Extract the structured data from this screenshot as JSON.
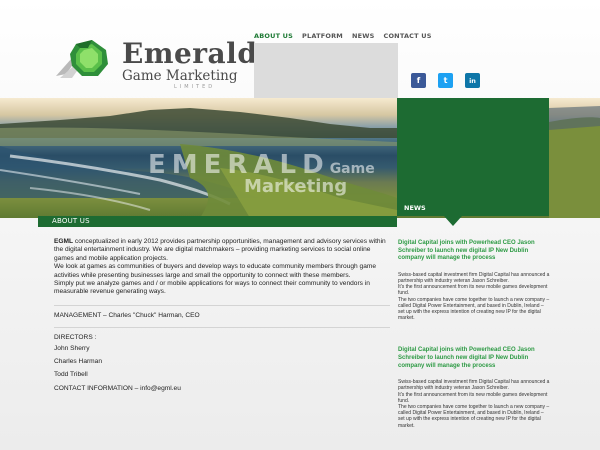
{
  "brand": {
    "title": "Emerald",
    "subtitle": "Game Marketing",
    "suffix": "LIMITED",
    "accent": "#1d6b32"
  },
  "nav": {
    "items": [
      "ABOUT US",
      "PLATFORM",
      "NEWS",
      "CONTACT US"
    ],
    "active": "ABOUT US"
  },
  "social": [
    {
      "icon": "facebook-icon",
      "glyph": "f",
      "color": "#3b5998"
    },
    {
      "icon": "twitter-icon",
      "glyph": "t",
      "color": "#1da1f2"
    },
    {
      "icon": "linkedin-icon",
      "glyph": "in",
      "color": "#0e76a8"
    }
  ],
  "banner": {
    "line1": "EMERALD",
    "line1b": "Game",
    "line2": "Marketing"
  },
  "sections": {
    "about_label": "ABOUT US",
    "news_label": "NEWS"
  },
  "about": {
    "lead": "EGML",
    "p1_rest": " conceptualized in early 2012 provides partnership opportunities, management and advisory services within the digital entertainment industry. We are digital matchmakers – providing marketing services to social online games and mobile application projects.",
    "p2": "We look at games as communities of buyers and develop ways to educate community members through game activities while presenting businesses large and small the opportunity to connect with these members.",
    "p3": "Simply put we analyze games and / or mobile applications for ways to connect their community to vendors in measurable revenue generating ways.",
    "management": "MANAGEMENT –  Charles \"Chuck\" Harman, CEO",
    "directors_title": "DIRECTORS :",
    "directors": [
      "John Sherry",
      "Charles Harman",
      "Todd Tribell"
    ],
    "contact": "CONTACT  INFORMATION – info@egml.eu"
  },
  "news": [
    {
      "headline": "Digital Capital joins with Powerhead CEO Jason Schreiber to launch new digital IP New Dublin company will manage the process",
      "body1": "Swiss-based capital investment firm Digital Capital has announced a partnership with industry veteran Jason Schreiber.",
      "body2": "It's the first announcement from its new mobile games development fund.",
      "body3": "The two companies have come together to launch a new company – called Digital Power Entertainment, and based in Dublin, Ireland – set up with the express intention of creating new IP for the digital market."
    },
    {
      "headline": "Digital Capital joins with Powerhead CEO Jason Schreiber to launch new digital IP New Dublin company will manage the process",
      "body1": "Swiss-based capital investment firm Digital Capital has announced a partnership with industry veteran Jason Schreiber.",
      "body2": "It's the first announcement from its new mobile games development fund.",
      "body3": "The two companies have come together to launch a new company – called Digital Power Entertainment, and based in Dublin, Ireland – set up with the express intention of creating new IP for the digital market."
    }
  ]
}
